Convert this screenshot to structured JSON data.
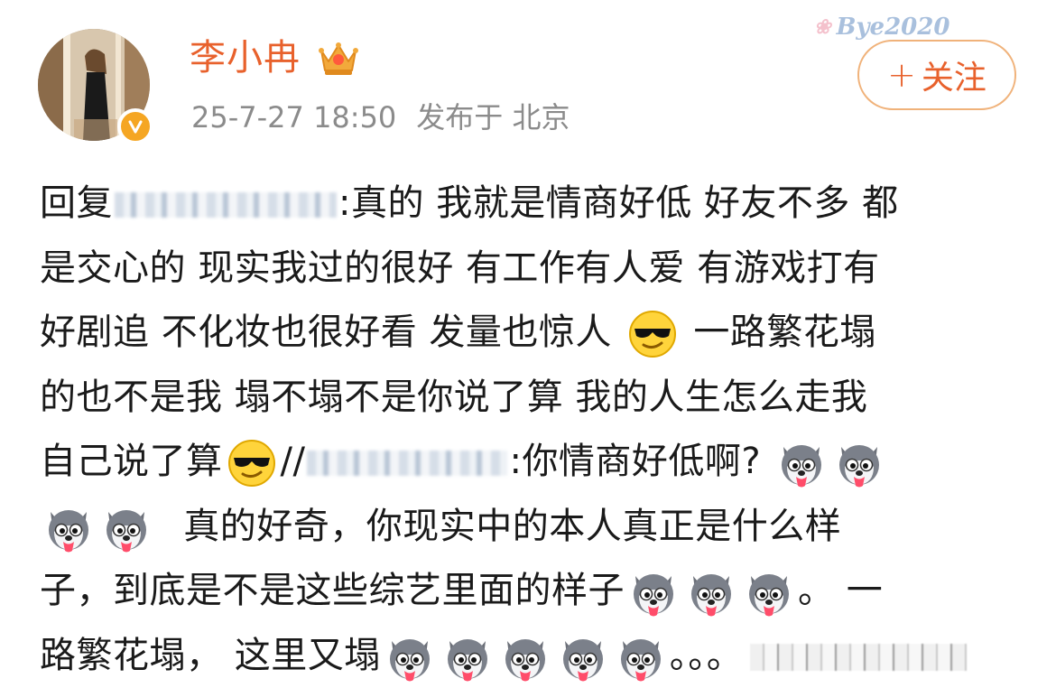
{
  "post": {
    "author": {
      "name": "李小冉",
      "crown_icon": "crown-icon",
      "verified_icon": "verified-v-icon",
      "verified_color": "#f5a623"
    },
    "date": "25-7-27 18:50",
    "location_label": "发布于 北京",
    "watermark": "Bye2020",
    "follow_label": "关注",
    "follow_plus": "+",
    "accent_color": "#e8612c",
    "body": {
      "line1_prefix": "回复",
      "line1_sep": ":",
      "line1_text": "真的 我就是情商好低 好友不多 都",
      "line2": "是交心的 现实我过的很好 有工作有人爱 有游戏打有",
      "line3_text": "好剧追 不化妆也很好看 发量也惊人",
      "line3_tail": "一路繁花塌",
      "line4": "的也不是我 塌不塌不是你说了算 我的人生怎么走我",
      "line5_text": "自己说了算",
      "line5_slash": "//",
      "line5_sep": ":",
      "line5_quote": "你情商好低啊?",
      "line6_text": "真的好奇，你现实中的本人真正是什么样",
      "line7_text": "子，到底是不是这些综艺里面的样子",
      "line7_tail": "。 一",
      "line8_text": "路繁花塌，  这里又塌",
      "line8_dots": "。。。"
    },
    "emoji_names": {
      "cool": "sunglasses-emoji-icon",
      "husky": "husky-emoji-icon"
    }
  }
}
